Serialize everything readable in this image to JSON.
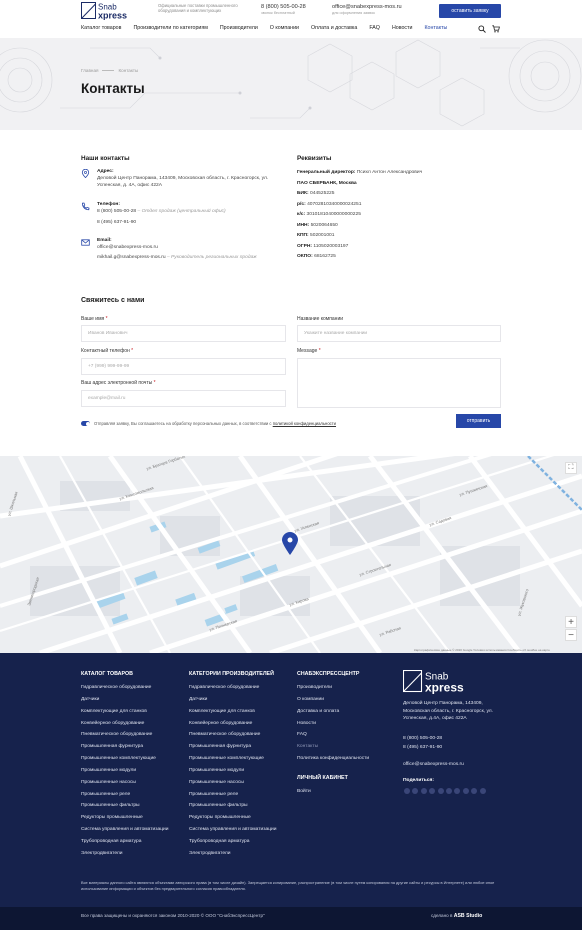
{
  "header": {
    "logo_text": "Snab Xpress",
    "tagline": "Официальные поставки промышленного оборудования и комплектующих",
    "phone": "8 (800) 505-00-28",
    "phone_note": "звонок бесплатный",
    "email": "office@snabexpress-mos.ru",
    "email_note": "для оформления заявок",
    "cta_label": "оставить заявку"
  },
  "nav": {
    "items": [
      "Каталог товаров",
      "Производители по категориям",
      "Производители",
      "О компании",
      "Оплата и доставка",
      "FAQ",
      "Новости",
      "Контакты"
    ],
    "active": "Контакты",
    "icons": [
      "search-icon",
      "cart-icon"
    ]
  },
  "hero": {
    "breadcrumb_home": "Главная",
    "breadcrumb_current": "Контакты",
    "title": "Контакты"
  },
  "contacts": {
    "heading": "Наши контакты",
    "address_label": "Адрес:",
    "address": "Деловой Центр Панорама, 143409, Московская область, г. Красногорск, ул. Успенская, д. 4А, офис 422А",
    "phone_label": "Телефон:",
    "phone1": "8 (800) 505-00-28",
    "phone1_note": "– Отдел продаж (центральный офис)",
    "phone2": "8 (495) 637-91-90",
    "email_label": "Email:",
    "email1": "office@snabexpress-mos.ru",
    "email2": "mikhail.g@snabexpress-mos.ru",
    "email2_note": "– Руководитель региональных продаж"
  },
  "requisites": {
    "heading": "Реквизиты",
    "director_label": "Генеральный директор:",
    "director": "Психл Антон Александрович",
    "bank": "ПАО СБЕРБАНК, Москва",
    "bik_label": "БИК:",
    "bik": "044525225",
    "rs_label": "р/с:",
    "rs": "40702810340000024251",
    "ks_label": "к/с:",
    "ks": "30101810400000000225",
    "inn_label": "ИНН:",
    "inn": "5020064650",
    "kpp_label": "КПП:",
    "kpp": "502001001",
    "ogrn_label": "ОГРН:",
    "ogrn": "1105020003197",
    "okpo_label": "ОКПО:",
    "okpo": "68162725"
  },
  "form": {
    "heading": "Свяжитесь с нами",
    "name_label": "Ваше имя",
    "name_placeholder": "Иванов Иванович",
    "phone_label": "Контактный телефон",
    "phone_placeholder": "+7 (999) 999-99-99",
    "email_label": "Ваш адрес электронной почты",
    "email_placeholder": "example@mail.ru",
    "company_label": "Название компании",
    "company_placeholder": "Укажите название компании",
    "message_label": "Message",
    "required_mark": "*",
    "agree_text": "Отправляя заявку, Вы соглашаетесь на обработку персональных данных, в соответствии с ",
    "agree_link": "политикой конфиденциальности",
    "submit_label": "отправить"
  },
  "map": {
    "attribution": "Картографические данные © 2020 Google   Условия использования   Сообщить об ошибке на карте",
    "zoom_in": "+",
    "zoom_out": "−",
    "streets": [
      "ул. Братцев Горбатых",
      "ул. Успенская",
      "ул. Пионерская",
      "ул. Кирова",
      "ул. Школьная",
      "Звенигородская",
      "ул. Садовая",
      "ул. Жуковского",
      "ул. Строительная",
      "ул. Комсомольская",
      "ул. Пушкинская",
      "ул. Рабочая"
    ]
  },
  "footer": {
    "col1_title": "КАТАЛОГ ТОВАРОВ",
    "col1": [
      "Гидравлическое оборудование",
      "Датчики",
      "Комплектующие для станков",
      "Конвейерное оборудование",
      "Пневматическое оборудование",
      "Промышленная фурнитура",
      "Промышленные комплектующие",
      "Промышленные модули",
      "Промышленные насосы",
      "Промышленные реле",
      "Промышленные фильтры",
      "Редукторы промышленные",
      "Система управления и автоматизации",
      "Трубопроводная арматура",
      "Электродвигатели"
    ],
    "col2_title": "КАТЕГОРИИ ПРОИЗВОДИТЕЛЕЙ",
    "col2": [
      "Гидравлическое оборудование",
      "Датчики",
      "Комплектующие для станков",
      "Конвейерное оборудование",
      "Пневматическое оборудование",
      "Промышленная фурнитура",
      "Промышленные комплектующие",
      "Промышленные модули",
      "Промышленные насосы",
      "Промышленные реле",
      "Промышленные фильтры",
      "Редукторы промышленные",
      "Система управления и автоматизации",
      "Трубопроводная арматура",
      "Электродвигатели"
    ],
    "col3_title": "СНАБЭКСПРЕССЦЕНТР",
    "col3": [
      "Производители",
      "О компании",
      "Доставка и оплата",
      "Новости",
      "FAQ",
      "Контакты",
      "Политика конфиденциальности"
    ],
    "col3_active": "Контакты",
    "cabinet_title": "ЛИЧНЫЙ КАБИНЕТ",
    "cabinet_link": "Войти",
    "logo_text": "Snab Xpress",
    "address": "Деловой Центр Панорама, 143409, Московская область, г. Красногорск, ул. Успенская, д.4А, офис 422А",
    "phone1": "8 (800) 505-00-28",
    "phone2": "8 (495) 637-91-90",
    "email": "office@snabexpress-mos.ru",
    "share_label": "Поделиться:",
    "share_icons": [
      "vk-icon",
      "facebook-icon",
      "ok-icon",
      "twitter-icon",
      "viber-icon",
      "whatsapp-icon",
      "skype-icon",
      "telegram-icon",
      "mail-icon",
      "link-icon"
    ],
    "note": "Все материалы данного сайта являются объектами авторского права (в том числе дизайн). Запрещается копирование, распространение (в том числе путем копирования на другие сайты и ресурсы в Интернете) или любое иное использование информации и объектов без предварительного согласия правообладателя.",
    "copyright": "Все права защищены и охраняются законом 2010-2020 © ООО \"СнабЭкспрессЦентр\"",
    "made_by_label": "сделано в",
    "made_by": "ASB Studio"
  },
  "colors": {
    "accent": "#2747a8",
    "footer_bg": "#16224c",
    "footer_bottom": "#0d1633",
    "required": "#c8181e"
  }
}
